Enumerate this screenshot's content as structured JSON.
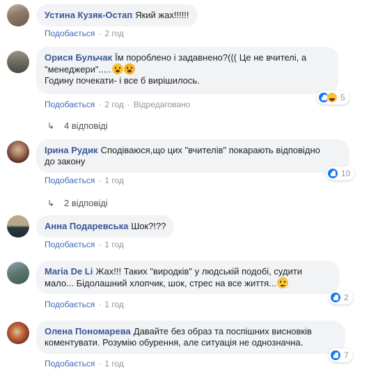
{
  "action_labels": {
    "like": "Подобається",
    "edited": "Відредаговано"
  },
  "comments": [
    {
      "author": "Устина Кузяк-Остап",
      "text": "Який жах!!!!!!",
      "time": "2 год",
      "reactions": null,
      "avatar_colors": [
        "#6b5a4e",
        "#c8b8a6"
      ]
    },
    {
      "author": "Орися Бульчак",
      "text_line1": "Їм пороблено і задавнено?((( Це не вчителі, а",
      "text_line2": "\"менеджери\".....",
      "text_line3": "Годину почекати- і все б вирішилось.",
      "time": "2 год",
      "edited": true,
      "reactions": {
        "count": "5",
        "icons": [
          "like-icon",
          "haha-icon"
        ]
      },
      "replies": "4 відповіді",
      "avatar_colors": [
        "#4a4a44",
        "#9a9486"
      ]
    },
    {
      "author": "Ірина Рудик",
      "text_line1": "Сподіваюся,що цих \"вчителів\" покарають відповідно",
      "text_line2": "до закону",
      "time": "1 год",
      "reactions": {
        "count": "10",
        "icons": [
          "like-icon"
        ]
      },
      "replies": "2 відповіді",
      "avatar_colors": [
        "#5c3326",
        "#d9b59e"
      ]
    },
    {
      "author": "Анна Подаревська",
      "text": "Шок?!??",
      "time": "1 год",
      "reactions": null,
      "avatar_colors": [
        "#2c3a46",
        "#b7a98a"
      ]
    },
    {
      "author": "Maria De Li",
      "text_line1": "Жах!!! Таких \"виродків\" у людській подобі, судити",
      "text_line2": "мало... Бідолашний хлопчик, шок, стрес на все життя...",
      "time": "1 год",
      "reactions": {
        "count": "2",
        "icons": [
          "like-icon"
        ]
      },
      "avatar_colors": [
        "#3d5a48",
        "#8fa6b4"
      ]
    },
    {
      "author": "Олена Пономарева",
      "text_line1": "Давайте без образ та поспішних висновків",
      "text_line2": "коментувати. Розумію обурення, але ситуація не однозначна.",
      "time": "1 год",
      "reactions": {
        "count": "7",
        "icons": [
          "like-icon"
        ]
      },
      "avatar_colors": [
        "#8a3a2a",
        "#d8c6a4"
      ]
    }
  ]
}
